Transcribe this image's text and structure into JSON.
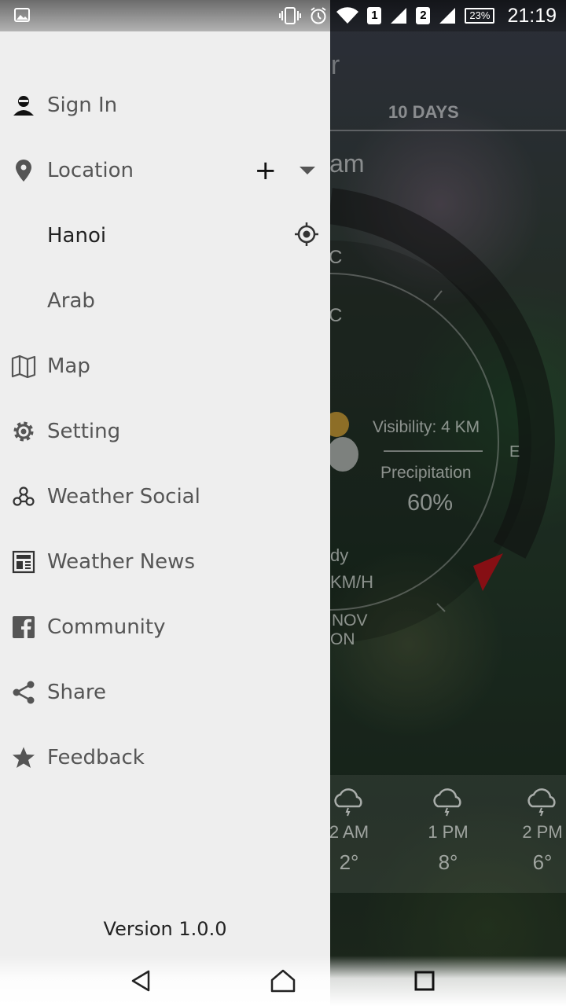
{
  "status_bar": {
    "time": "21:19",
    "battery": "23%",
    "sim1": "1",
    "sim2": "2",
    "icons": [
      "image-icon",
      "vibrate-icon",
      "alarm-icon",
      "wifi-icon",
      "signal-icon",
      "signal-icon",
      "battery-icon"
    ]
  },
  "drawer": {
    "items": [
      {
        "label": "Sign In",
        "icon": "user-icon"
      },
      {
        "label": "Location",
        "icon": "location-pin-icon"
      },
      {
        "label": "Hanoi",
        "icon": "my-location-icon"
      },
      {
        "label": "Arab"
      },
      {
        "label": "Map",
        "icon": "map-icon"
      },
      {
        "label": "Setting",
        "icon": "gear-icon"
      },
      {
        "label": "Weather Social",
        "icon": "social-icon"
      },
      {
        "label": "Weather News",
        "icon": "news-icon"
      },
      {
        "label": "Community",
        "icon": "facebook-icon"
      },
      {
        "label": "Share",
        "icon": "share-icon"
      },
      {
        "label": "Feedback",
        "icon": "star-icon"
      }
    ],
    "location_add": "+",
    "version": "Version 1.0.0"
  },
  "background": {
    "title_fragment": "er",
    "tab": "10 DAYS",
    "city_fragment": "Nam",
    "temp_fragment_1": "C",
    "temp_fragment_2": "C",
    "visibility": "Visibility: 4 KM",
    "precipitation_label": "Precipitation",
    "precipitation_value": "60%",
    "compass_e": "E",
    "condition_fragment": "dy",
    "wind_fragment": "KM/H",
    "date_fragment_1": "NOV",
    "date_fragment_2": "ON",
    "forecast": [
      {
        "time": "2 AM",
        "temp": "2°"
      },
      {
        "time": "1 PM",
        "temp": "8°"
      },
      {
        "time": "2 PM",
        "temp": "6°"
      }
    ]
  },
  "colors": {
    "drawer_bg": "#eeeeee",
    "label_text": "#555555",
    "active_text": "#222222",
    "accent_red": "#b3151b"
  }
}
